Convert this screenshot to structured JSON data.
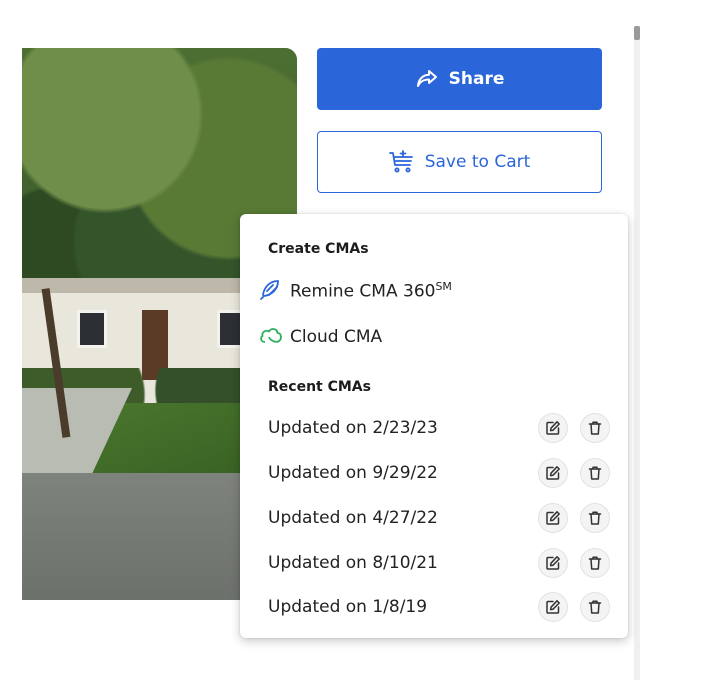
{
  "actions": {
    "share_label": "Share",
    "save_to_cart_label": "Save to Cart"
  },
  "cma_menu": {
    "create_heading": "Create CMAs",
    "options": [
      {
        "label": "Remine CMA 360",
        "superscript": "SM",
        "icon": "remine-logo-icon",
        "color": "#2a66d9"
      },
      {
        "label": "Cloud CMA",
        "icon": "cloud-icon",
        "color": "#2fae5f"
      }
    ],
    "recent_heading": "Recent CMAs",
    "recent": [
      {
        "label": "Updated on 2/23/23"
      },
      {
        "label": "Updated on 9/29/22"
      },
      {
        "label": "Updated on 4/27/22"
      },
      {
        "label": "Updated on 8/10/21"
      },
      {
        "label": "Updated on 1/8/19"
      }
    ],
    "row_actions": [
      "edit-icon",
      "trash-icon"
    ]
  },
  "colors": {
    "primary": "#2a66d9",
    "text": "#222222"
  }
}
